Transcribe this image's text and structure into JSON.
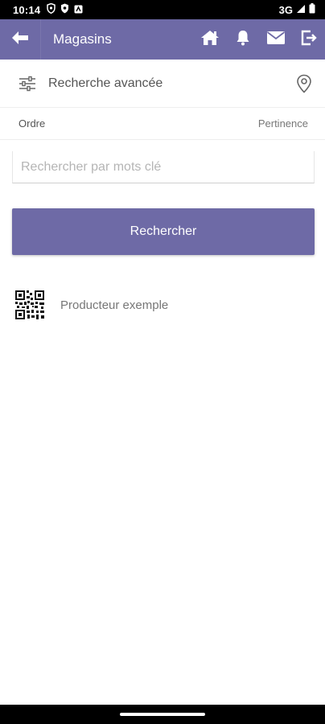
{
  "status_bar": {
    "time": "10:14",
    "network": "3G",
    "icons": [
      "shield-icon",
      "shield-filled-icon",
      "notification-box-icon",
      "signal-icon",
      "battery-icon"
    ]
  },
  "app_bar": {
    "title": "Magasins",
    "background": "#6e6aa6",
    "icons": [
      "back-arrow-icon",
      "home-icon",
      "bell-icon",
      "mail-icon",
      "logout-icon"
    ]
  },
  "advanced_search": {
    "label": "Recherche avancée",
    "icons": [
      "filter-sliders-icon",
      "location-pin-icon"
    ]
  },
  "order": {
    "label": "Ordre",
    "value": "Pertinence"
  },
  "search": {
    "placeholder": "Rechercher par mots clé",
    "value": ""
  },
  "search_button": {
    "label": "Rechercher",
    "color": "#6e6aa6"
  },
  "results": [
    {
      "name": "Producteur exemple",
      "icon": "qr-code-icon"
    }
  ]
}
